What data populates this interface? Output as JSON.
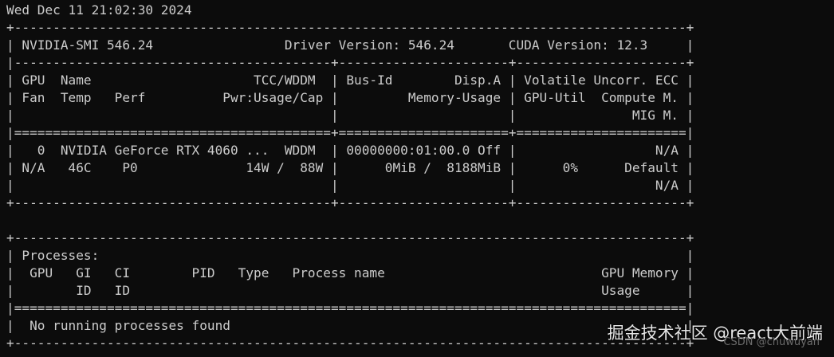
{
  "window": {
    "type": "terminal",
    "background": "#0c0c0c",
    "foreground": "#cccccc"
  },
  "terminal": {
    "lines": [
      "Wed Dec 11 21:02:30 2024",
      "+---------------------------------------------------------------------------------------+",
      "| NVIDIA-SMI 546.24                 Driver Version: 546.24       CUDA Version: 12.3     |",
      "|-----------------------------------------+----------------------+----------------------+",
      "| GPU  Name                     TCC/WDDM  | Bus-Id        Disp.A | Volatile Uncorr. ECC |",
      "| Fan  Temp   Perf          Pwr:Usage/Cap |         Memory-Usage | GPU-Util  Compute M. |",
      "|                                         |                      |               MIG M. |",
      "|=========================================+======================+======================|",
      "|   0  NVIDIA GeForce RTX 4060 ...  WDDM  | 00000000:01:00.0 Off |                  N/A |",
      "| N/A   46C    P0              14W /  88W |      0MiB /  8188MiB |      0%      Default |",
      "|                                         |                      |                  N/A |",
      "+-----------------------------------------+----------------------+----------------------+",
      "",
      "+---------------------------------------------------------------------------------------+",
      "| Processes:                                                                            |",
      "|  GPU   GI   CI        PID   Type   Process name                            GPU Memory |",
      "|        ID   ID                                                             Usage      |",
      "|=======================================================================================|",
      "|  No running processes found                                                           |",
      "+---------------------------------------------------------------------------------------+"
    ]
  },
  "watermark": {
    "text": "掘金技术社区 @react大前端",
    "subtext": "CSDN @chuwuyan"
  }
}
